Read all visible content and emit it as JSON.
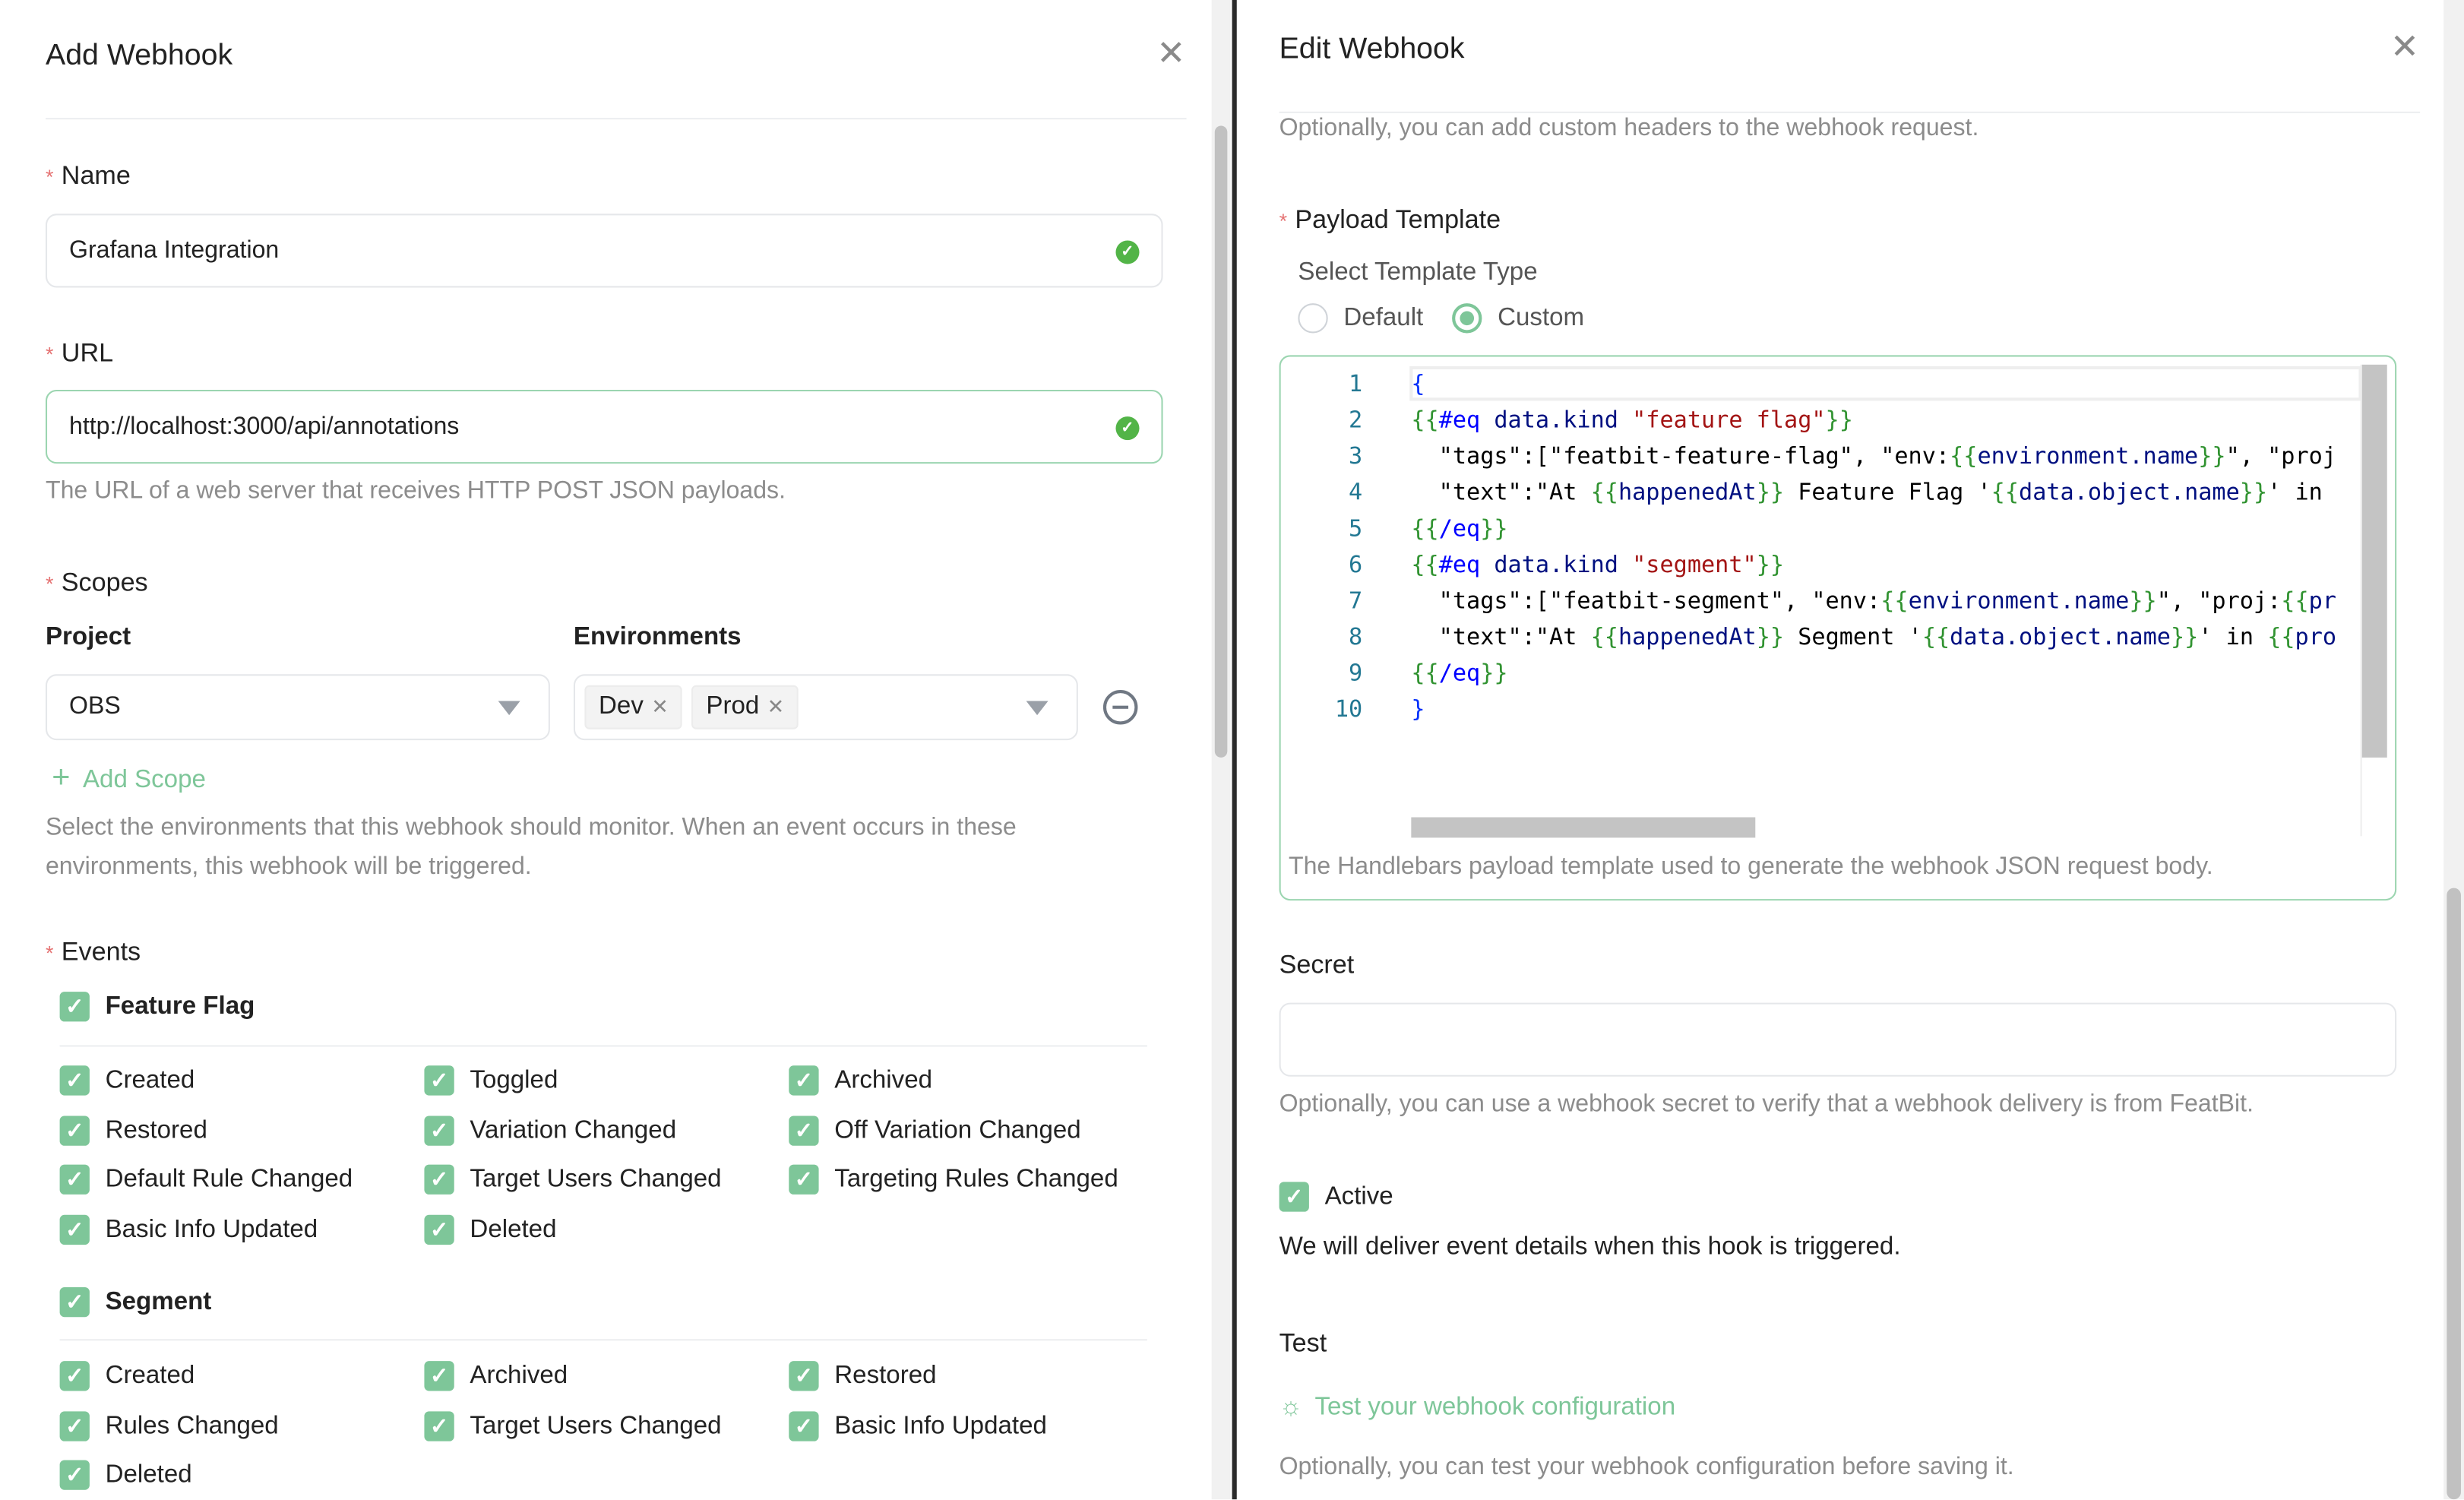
{
  "left": {
    "title": "Add Webhook",
    "name": {
      "label": "Name",
      "value": "Grafana Integration"
    },
    "url": {
      "label": "URL",
      "value": "http://localhost:3000/api/annotations",
      "help": "The URL of a web server that receives HTTP POST JSON payloads."
    },
    "scopes": {
      "label": "Scopes",
      "project_label": "Project",
      "env_label": "Environments",
      "project_value": "OBS",
      "envs": [
        "Dev",
        "Prod"
      ],
      "add_label": "Add Scope",
      "help_1": "Select the environments that this webhook should monitor. When an event occurs in these",
      "help_2": "environments, this webhook will be triggered."
    },
    "events": {
      "label": "Events",
      "feature_flag": {
        "label": "Feature Flag",
        "checked": true,
        "items": [
          {
            "label": "Created",
            "checked": true
          },
          {
            "label": "Toggled",
            "checked": true
          },
          {
            "label": "Archived",
            "checked": true
          },
          {
            "label": "Restored",
            "checked": true
          },
          {
            "label": "Variation Changed",
            "checked": true
          },
          {
            "label": "Off Variation Changed",
            "checked": true
          },
          {
            "label": "Default Rule Changed",
            "checked": true
          },
          {
            "label": "Target Users Changed",
            "checked": true
          },
          {
            "label": "Targeting Rules Changed",
            "checked": true
          },
          {
            "label": "Basic Info Updated",
            "checked": true
          },
          {
            "label": "Deleted",
            "checked": true
          }
        ]
      },
      "segment": {
        "label": "Segment",
        "checked": true,
        "items": [
          {
            "label": "Created",
            "checked": true
          },
          {
            "label": "Archived",
            "checked": true
          },
          {
            "label": "Restored",
            "checked": true
          },
          {
            "label": "Rules Changed",
            "checked": true
          },
          {
            "label": "Target Users Changed",
            "checked": true
          },
          {
            "label": "Basic Info Updated",
            "checked": true
          },
          {
            "label": "Deleted",
            "checked": true
          }
        ]
      }
    }
  },
  "right": {
    "title": "Edit Webhook",
    "headers_help": "Optionally, you can add custom headers to the webhook request.",
    "payload": {
      "label": "Payload Template",
      "type_label": "Select Template Type",
      "options": [
        "Default",
        "Custom"
      ],
      "selected": "Custom",
      "code_lines": [
        [
          [
            "{",
            "bracket"
          ]
        ],
        [
          [
            "{{",
            "brace"
          ],
          [
            "#eq",
            "kw"
          ],
          [
            " data.kind ",
            "var"
          ],
          [
            "\"feature flag\"",
            "str"
          ],
          [
            "}}",
            "brace"
          ]
        ],
        [
          [
            "  \"tags\":[\"featbit-feature-flag\", \"env:",
            "plain"
          ],
          [
            "{{",
            "brace"
          ],
          [
            "environment.name",
            "var"
          ],
          [
            "}}",
            "brace"
          ],
          [
            "\", \"proj",
            "plain"
          ]
        ],
        [
          [
            "  \"text\":\"At ",
            "plain"
          ],
          [
            "{{",
            "brace"
          ],
          [
            "happenedAt",
            "var"
          ],
          [
            "}}",
            "brace"
          ],
          [
            " Feature Flag '",
            "plain"
          ],
          [
            "{{",
            "brace"
          ],
          [
            "data.object.name",
            "var"
          ],
          [
            "}}",
            "brace"
          ],
          [
            "' in",
            "plain"
          ]
        ],
        [
          [
            "{{",
            "brace"
          ],
          [
            "/eq",
            "kw"
          ],
          [
            "}}",
            "brace"
          ]
        ],
        [
          [
            "{{",
            "brace"
          ],
          [
            "#eq",
            "kw"
          ],
          [
            " data.kind ",
            "var"
          ],
          [
            "\"segment\"",
            "str"
          ],
          [
            "}}",
            "brace"
          ]
        ],
        [
          [
            "  \"tags\":[\"featbit-segment\", \"env:",
            "plain"
          ],
          [
            "{{",
            "brace"
          ],
          [
            "environment.name",
            "var"
          ],
          [
            "}}",
            "brace"
          ],
          [
            "\", \"proj:",
            "plain"
          ],
          [
            "{{",
            "brace"
          ],
          [
            "pr",
            "var"
          ]
        ],
        [
          [
            "  \"text\":\"At ",
            "plain"
          ],
          [
            "{{",
            "brace"
          ],
          [
            "happenedAt",
            "var"
          ],
          [
            "}}",
            "brace"
          ],
          [
            " Segment '",
            "plain"
          ],
          [
            "{{",
            "brace"
          ],
          [
            "data.object.name",
            "var"
          ],
          [
            "}}",
            "brace"
          ],
          [
            "' in ",
            "plain"
          ],
          [
            "{{",
            "brace"
          ],
          [
            "pro",
            "var"
          ]
        ],
        [
          [
            "{{",
            "brace"
          ],
          [
            "/eq",
            "kw"
          ],
          [
            "}}",
            "brace"
          ]
        ],
        [
          [
            "}",
            "bracket"
          ]
        ]
      ],
      "help": "The Handlebars payload template used to generate the webhook JSON request body."
    },
    "secret": {
      "label": "Secret",
      "value": "",
      "help": "Optionally, you can use a webhook secret to verify that a webhook delivery is from FeatBit."
    },
    "active": {
      "label": "Active",
      "checked": true,
      "help": "We will deliver event details when this hook is triggered."
    },
    "test": {
      "label": "Test",
      "link": "Test your webhook configuration",
      "help": "Optionally, you can test your webhook configuration before saving it."
    }
  },
  "colors": {
    "accent": "#7ec699",
    "valid": "#52b447",
    "required": "#e57373"
  }
}
